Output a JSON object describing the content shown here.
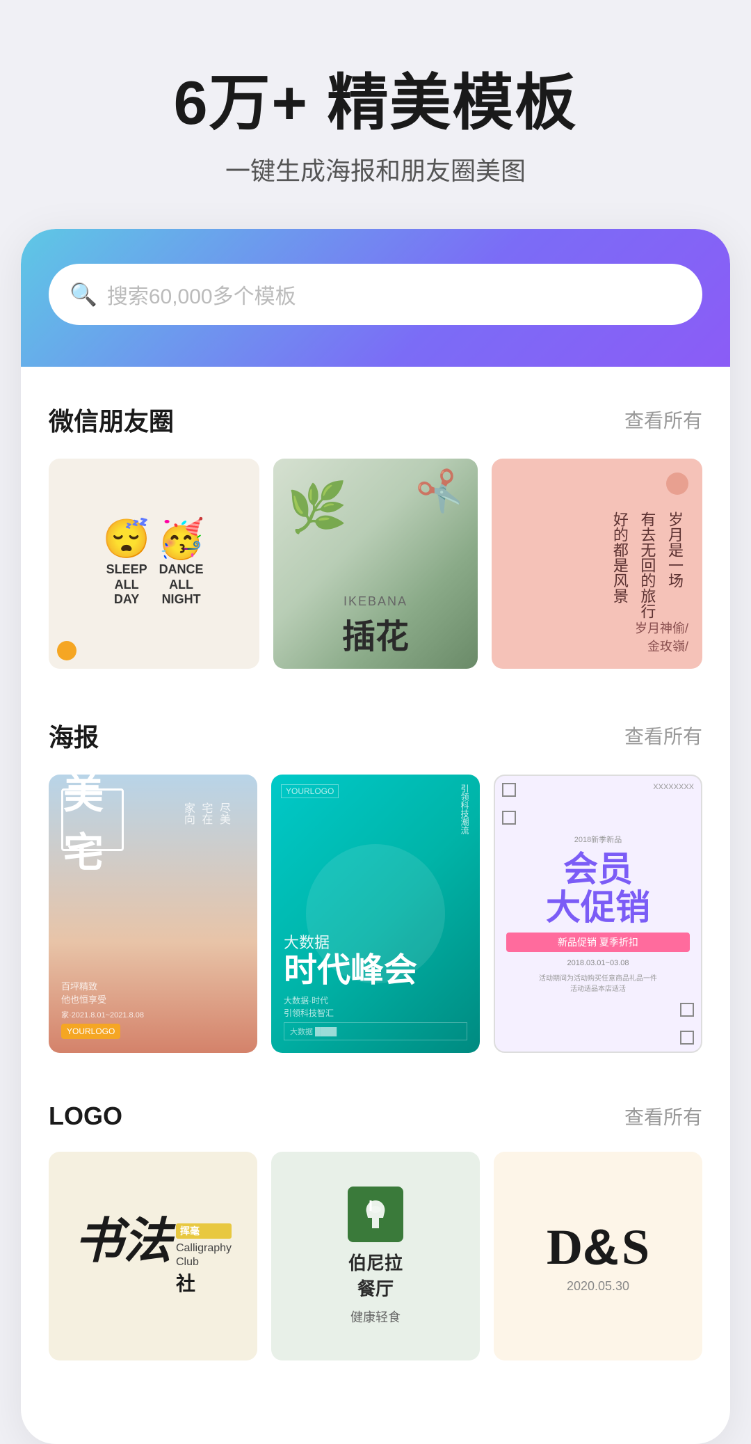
{
  "header": {
    "title": "6万+ 精美模板",
    "subtitle": "一键生成海报和朋友圈美图"
  },
  "search": {
    "placeholder": "搜索60,000多个模板"
  },
  "sections": {
    "wechat": {
      "title": "微信朋友圈",
      "link": "查看所有"
    },
    "poster": {
      "title": "海报",
      "link": "查看所有"
    },
    "logo": {
      "title": "LOGO",
      "link": "查看所有"
    }
  },
  "wechat_cards": [
    {
      "id": "sleep-dance",
      "sleep_label": "SLEEP ALL DAY",
      "dance_label": "DANCE ALL NIGHT"
    },
    {
      "id": "ikebana",
      "en_text": "IKEBANA",
      "cn_text": "插花"
    },
    {
      "id": "poem",
      "line1": "岁月是一场",
      "line2": "有去无回的旅行",
      "line3": "好好的都是风景",
      "footer1": "岁月神偷/",
      "footer2": "金玫嶺/"
    }
  ],
  "poster_cards": [
    {
      "id": "meizhai",
      "title": "美宅",
      "sub_vertical": "尽美\n宅在\n家向",
      "footer": "百坪精致\n他也恒享受",
      "date": "家·2021.8.01~2021.8.08",
      "brand": "YOURLOGO"
    },
    {
      "id": "shidai",
      "logo": "YOURLOGO",
      "intro": "引领科技潮流",
      "small": "大数据",
      "big": "时代峰会",
      "footer": "大数据·时代\n引领科技智汇",
      "brand": "大数据"
    },
    {
      "id": "huiyuan",
      "year": "2018新季新品",
      "title": "会员\n大促销",
      "bar": "新品促销 夏季折扣",
      "date1": "2018.03.01~03.08",
      "sub": "活动期间为活动购买任意商品礼品一件\n活动适品本店适活"
    }
  ],
  "logo_cards": [
    {
      "id": "calligraphy",
      "cn": "书法",
      "badge": "挥毫",
      "en1": "Calligraphy",
      "en2": "Club",
      "cn2": "社"
    },
    {
      "id": "restaurant",
      "name": "伯尼拉\n餐厅",
      "sub": "健康轻食"
    },
    {
      "id": "ds",
      "title": "D&S",
      "date": "2020.05.30"
    }
  ],
  "colors": {
    "gradient_start": "#5ec8e5",
    "gradient_end": "#8b5cf6",
    "accent_orange": "#f5a623",
    "accent_purple": "#7b5cf6",
    "card_bg_warm": "#f5f0e8",
    "card_bg_green": "#e8ede5",
    "card_bg_pink": "#f5c2b8"
  }
}
